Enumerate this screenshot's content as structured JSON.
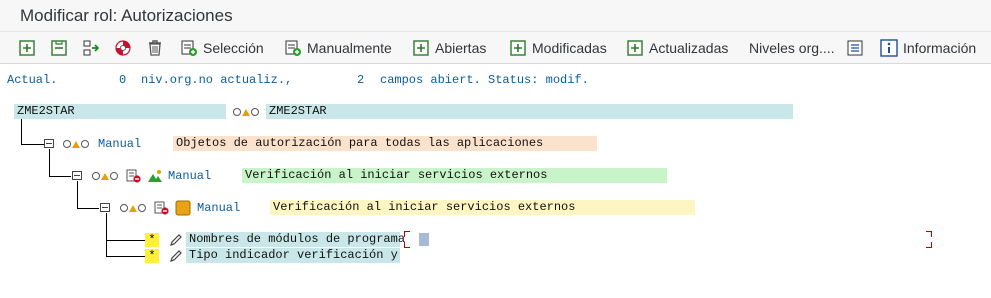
{
  "window": {
    "title": "Modificar rol: Autorizaciones"
  },
  "toolbar": {
    "seleccion": "Selección",
    "manualmente": "Manualmente",
    "abiertas": "Abiertas",
    "modificadas": "Modificadas",
    "actualizadas": "Actualizadas",
    "niveles": "Niveles org....",
    "informacion": "Información"
  },
  "status": {
    "actual_label": "Actual.",
    "org_count": "0",
    "org_text": "niv.org.no actualiz.,",
    "fields_count": "2",
    "fields_text": "campos abiert. Status: modif."
  },
  "tree": {
    "root_name": "ZME2STAR",
    "root_desc": "ZME2STAR",
    "level1": {
      "status": "Manual",
      "desc": "Objetos de autorización para todas las aplicaciones"
    },
    "level2": {
      "status": "Manual",
      "desc": "Verificación al iniciar servicios externos"
    },
    "level3": {
      "status": "Manual",
      "desc": "Verificación al iniciar servicios externos"
    },
    "fields": [
      {
        "marker": "*",
        "label": "Nombres de módulos de programa",
        "value": ""
      },
      {
        "marker": "*",
        "label": "Tipo indicador verificación y",
        "value": ""
      }
    ]
  },
  "colors": {
    "teal": "#c9e7e9",
    "peach": "#fbe2cc",
    "green": "#c9f3c9",
    "yellow": "#fdf6c3",
    "link_blue": "#0a5ea1"
  }
}
